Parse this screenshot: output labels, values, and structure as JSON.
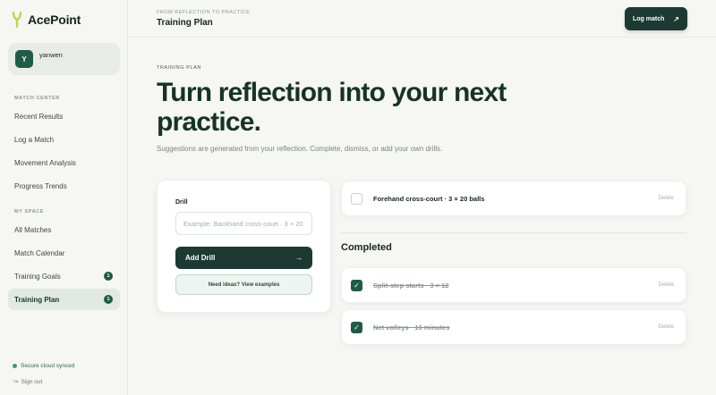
{
  "brand": {
    "name": "AcePoint"
  },
  "user": {
    "initial": "Y",
    "name": "yanwen"
  },
  "sidebar": {
    "match_center_label": "MATCH CENTER",
    "my_space_label": "MY SPACE",
    "match_center_items": [
      {
        "label": "Recent Results"
      },
      {
        "label": "Log a Match"
      },
      {
        "label": "Movement Analysis"
      },
      {
        "label": "Progress Trends"
      }
    ],
    "my_space_items": [
      {
        "label": "All Matches"
      },
      {
        "label": "Match Calendar"
      },
      {
        "label": "Training Goals",
        "badge": "1"
      },
      {
        "label": "Training Plan",
        "badge": "1",
        "active": true
      }
    ],
    "sync_status": "Secure cloud synced",
    "sign_out": "Sign out"
  },
  "header": {
    "eyebrow": "FROM REFLECTION TO PRACTICE",
    "title": "Training Plan",
    "log_match_label": "Log match"
  },
  "main": {
    "eyebrow": "TRAINING PLAN",
    "title_line1": "Turn reflection into your next",
    "title_line2": "practice.",
    "subtitle": "Suggestions are generated from your reflection. Complete, dismiss, or add your own drills.",
    "drill_form": {
      "label": "Drill",
      "placeholder": "Example: Backhand cross-court · 3 × 20",
      "add_label": "Add Drill",
      "ideas_label": "Need ideas? View examples"
    },
    "pending": [
      {
        "text": "Forehand cross-court · 3 × 20 balls",
        "delete": "Delete"
      }
    ],
    "completed_heading": "Completed",
    "completed": [
      {
        "text": "Split-step starts · 3 × 12",
        "delete": "Delete"
      },
      {
        "text": "Net volleys · 10 minutes",
        "delete": "Delete"
      }
    ]
  },
  "colors": {
    "accent_dark": "#1c3a31",
    "accent": "#1e5c47",
    "background": "#f6f6f3",
    "active_nav": "#e1e9e4"
  },
  "icons": {
    "brand": "tennis-racket-leaf-icon",
    "log_match": "arrow-up-right-icon",
    "add_drill": "arrow-right-icon",
    "checked": "checkmark-icon",
    "sync": "dot-icon",
    "sign_out": "arrow-return-icon"
  }
}
